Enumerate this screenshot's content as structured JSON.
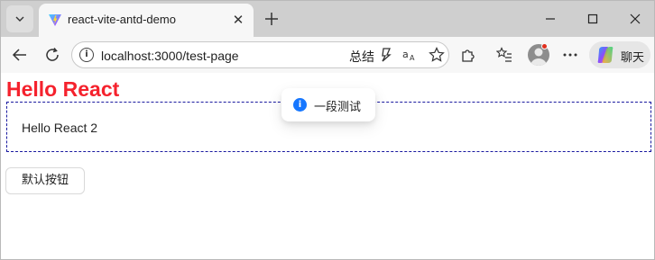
{
  "browser": {
    "tab": {
      "title": "react-vite-antd-demo",
      "close_glyph": "✕"
    },
    "address_bar": {
      "url": "localhost:3000/test-page",
      "summary_label": "总结"
    },
    "chat_label": "聊天",
    "icons": [
      "tab-list-icon",
      "vite-logo-icon",
      "close-icon",
      "plus-icon",
      "minimize-icon",
      "maximize-icon",
      "close-window-icon",
      "back-arrow-icon",
      "refresh-icon",
      "info-icon",
      "copilot-summary-icon",
      "read-aloud-icon",
      "favorite-star-icon",
      "extensions-icon",
      "favorites-list-icon",
      "profile-avatar-icon",
      "more-icon",
      "copilot-icon"
    ]
  },
  "page": {
    "title": "Hello React",
    "box_text": "Hello React 2",
    "default_button_label": "默认按钮",
    "message": {
      "icon_glyph": "i",
      "text": "一段测试"
    }
  },
  "colors": {
    "title_red": "#f5222d",
    "info_blue": "#1677ff",
    "dashed_border": "#1a1aa0"
  }
}
